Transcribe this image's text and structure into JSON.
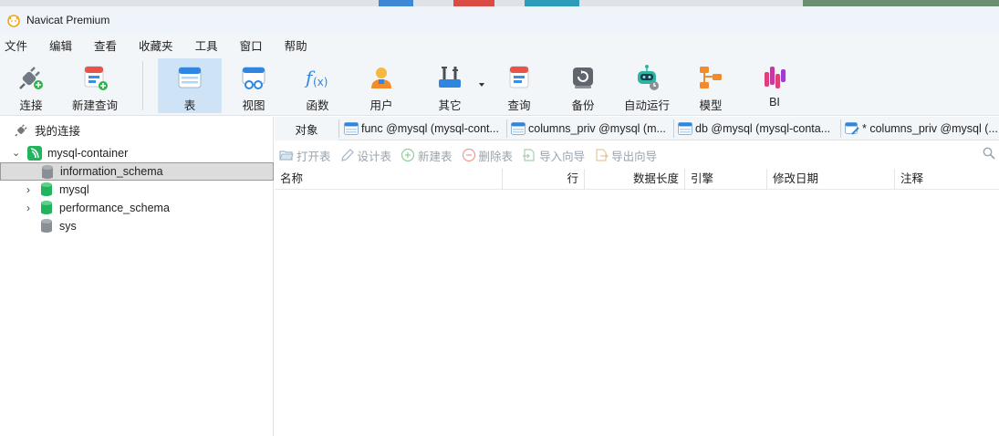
{
  "window": {
    "title": "Navicat Premium"
  },
  "menu": [
    "文件",
    "编辑",
    "查看",
    "收藏夹",
    "工具",
    "窗口",
    "帮助"
  ],
  "toolbar": {
    "connect": "连接",
    "new_query": "新建查询",
    "table": "表",
    "view": "视图",
    "function": "函数",
    "user": "用户",
    "other": "其它",
    "query": "查询",
    "backup": "备份",
    "auto_run": "自动运行",
    "model": "模型",
    "bi": "BI"
  },
  "sidebar": {
    "root": "我的连接",
    "connection": "mysql-container",
    "databases": [
      {
        "name": "information_schema",
        "selected": true,
        "expandable": false,
        "color": "#8a8f96"
      },
      {
        "name": "mysql",
        "selected": false,
        "expandable": true,
        "color": "#22b35e"
      },
      {
        "name": "performance_schema",
        "selected": false,
        "expandable": true,
        "color": "#22b35e"
      },
      {
        "name": "sys",
        "selected": false,
        "expandable": false,
        "color": "#8a8f96"
      }
    ]
  },
  "tabs": {
    "objects": "对象",
    "items": [
      "func @mysql (mysql-cont...",
      "columns_priv @mysql (m...",
      "db @mysql (mysql-conta...",
      "* columns_priv @mysql (..."
    ]
  },
  "actions": {
    "open_table": "打开表",
    "design_table": "设计表",
    "new_table": "新建表",
    "delete_table": "删除表",
    "import_wizard": "导入向导",
    "export_wizard": "导出向导"
  },
  "columns": {
    "name": "名称",
    "rows": "行",
    "data_length": "数据长度",
    "engine": "引擎",
    "modified": "修改日期",
    "comment": "注释"
  },
  "colors": {
    "accent": "#1e88e5",
    "active_tool_bg": "#cfe3f7",
    "db_green": "#22b35e",
    "db_gray": "#8a8f96"
  }
}
